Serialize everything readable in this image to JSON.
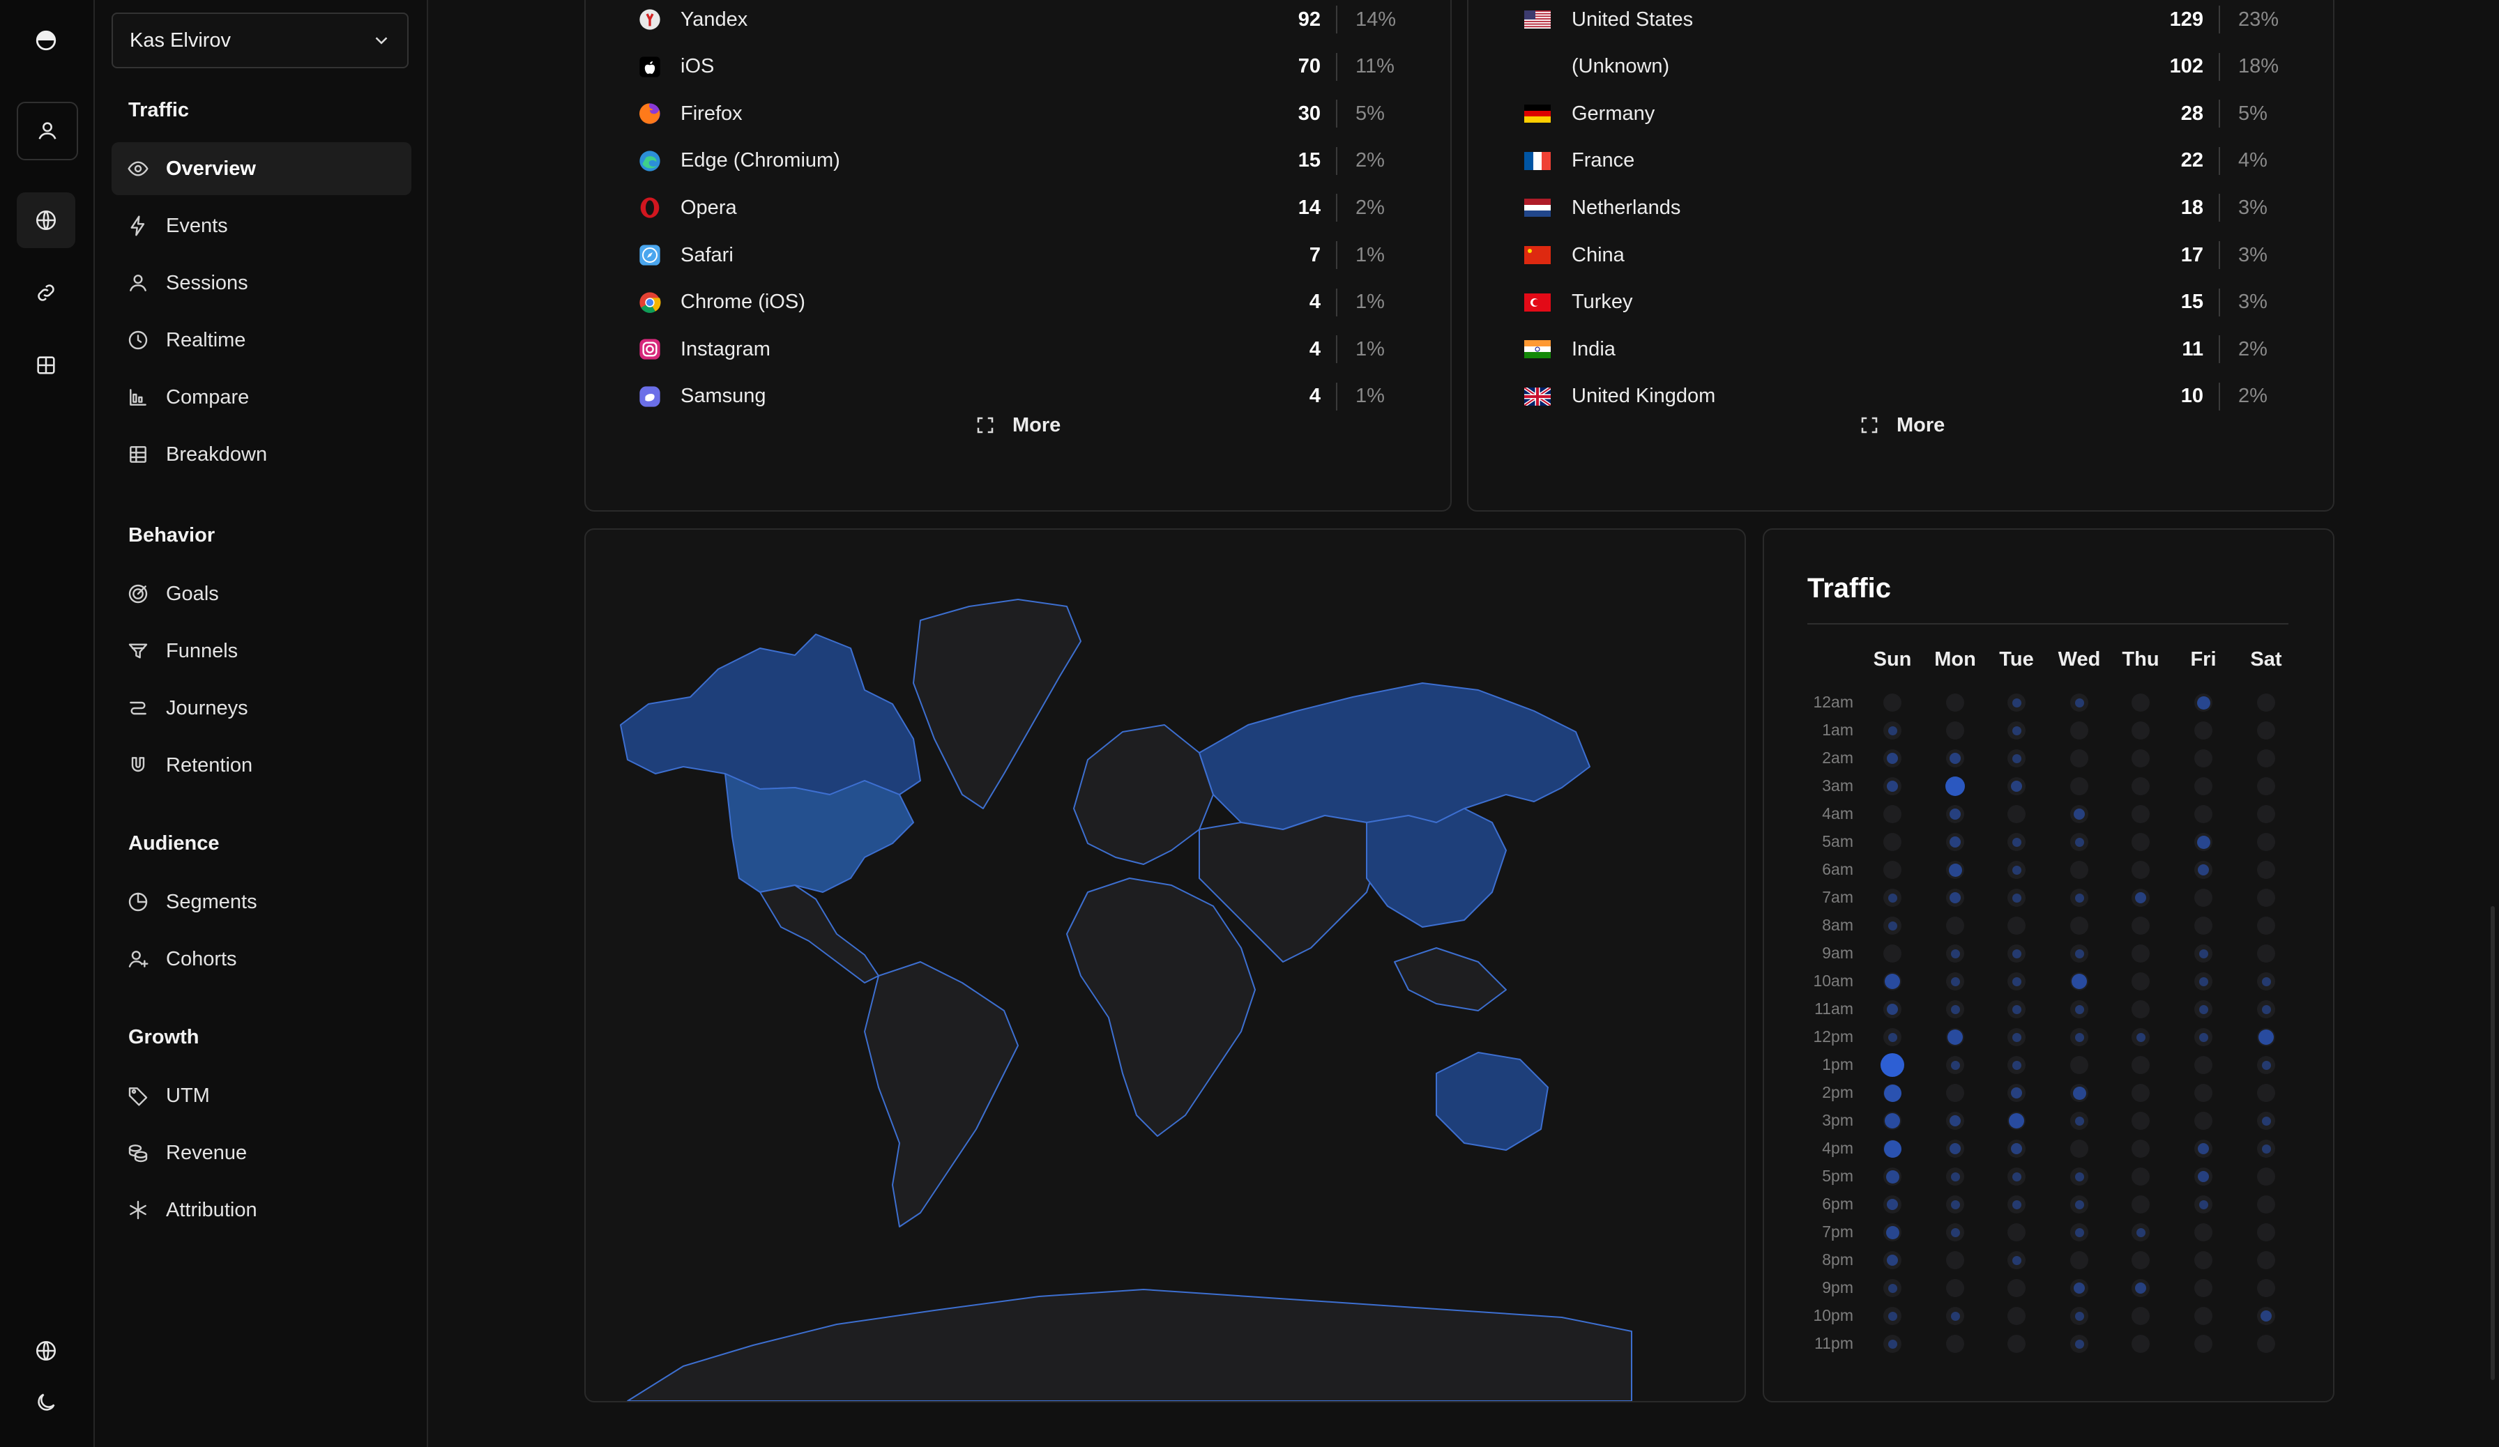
{
  "sidebar": {
    "team": "Kas Elvirov",
    "sections": [
      {
        "title": "Traffic",
        "items": [
          {
            "label": "Overview",
            "icon": "eye-icon",
            "active": true
          },
          {
            "label": "Events",
            "icon": "lightning-icon"
          },
          {
            "label": "Sessions",
            "icon": "user-icon"
          },
          {
            "label": "Realtime",
            "icon": "clock-icon"
          },
          {
            "label": "Compare",
            "icon": "compare-chart-icon"
          },
          {
            "label": "Breakdown",
            "icon": "table-icon"
          }
        ]
      },
      {
        "title": "Behavior",
        "items": [
          {
            "label": "Goals",
            "icon": "target-icon"
          },
          {
            "label": "Funnels",
            "icon": "funnel-icon"
          },
          {
            "label": "Journeys",
            "icon": "journey-icon"
          },
          {
            "label": "Retention",
            "icon": "magnet-icon"
          }
        ]
      },
      {
        "title": "Audience",
        "items": [
          {
            "label": "Segments",
            "icon": "pie-icon"
          },
          {
            "label": "Cohorts",
            "icon": "user-plus-icon"
          }
        ]
      },
      {
        "title": "Growth",
        "items": [
          {
            "label": "UTM",
            "icon": "tag-icon"
          },
          {
            "label": "Revenue",
            "icon": "coins-icon"
          },
          {
            "label": "Attribution",
            "icon": "asterisk-icon"
          }
        ]
      }
    ]
  },
  "browsers": {
    "rows": [
      {
        "label": "Yandex",
        "count": "92",
        "pct": "14%",
        "icon": "yandex-icon",
        "color": "#e8e8e8",
        "mark": "#d22222"
      },
      {
        "label": "iOS",
        "count": "70",
        "pct": "11%",
        "icon": "apple-icon",
        "color": "#ffffff",
        "mark": "#000000"
      },
      {
        "label": "Firefox",
        "count": "30",
        "pct": "5%",
        "icon": "firefox-icon",
        "color": "#ff7a1a",
        "mark": "#8a3ad6"
      },
      {
        "label": "Edge (Chromium)",
        "count": "15",
        "pct": "2%",
        "icon": "edge-icon",
        "color": "#2c8fd8",
        "mark": "#3ed08a"
      },
      {
        "label": "Opera",
        "count": "14",
        "pct": "2%",
        "icon": "opera-icon",
        "color": "#d1161f",
        "mark": "#131313"
      },
      {
        "label": "Safari",
        "count": "7",
        "pct": "1%",
        "icon": "safari-icon",
        "color": "#4aa6ee",
        "mark": "#ffffff"
      },
      {
        "label": "Chrome (iOS)",
        "count": "4",
        "pct": "1%",
        "icon": "chrome-icon",
        "color": "#e34133",
        "mark": "#4285f4"
      },
      {
        "label": "Instagram",
        "count": "4",
        "pct": "1%",
        "icon": "instagram-icon",
        "color": "#d6287a",
        "mark": "#ffffff"
      },
      {
        "label": "Samsung",
        "count": "4",
        "pct": "1%",
        "icon": "samsung-icon",
        "color": "#6b6fe8",
        "mark": "#ffffff"
      }
    ],
    "more_label": "More"
  },
  "countries": {
    "rows": [
      {
        "label": "United States",
        "count": "129",
        "pct": "23%",
        "flag": "us"
      },
      {
        "label": "(Unknown)",
        "count": "102",
        "pct": "18%",
        "flag": "none"
      },
      {
        "label": "Germany",
        "count": "28",
        "pct": "5%",
        "flag": "de"
      },
      {
        "label": "France",
        "count": "22",
        "pct": "4%",
        "flag": "fr"
      },
      {
        "label": "Netherlands",
        "count": "18",
        "pct": "3%",
        "flag": "nl"
      },
      {
        "label": "China",
        "count": "17",
        "pct": "3%",
        "flag": "cn"
      },
      {
        "label": "Turkey",
        "count": "15",
        "pct": "3%",
        "flag": "tr"
      },
      {
        "label": "India",
        "count": "11",
        "pct": "2%",
        "flag": "in"
      },
      {
        "label": "United Kingdom",
        "count": "10",
        "pct": "2%",
        "flag": "gb"
      }
    ],
    "more_label": "More"
  },
  "map": {
    "accent": "#1e3f7a",
    "accent_strong": "#24508f",
    "border_color": "#3d6fd0",
    "base_color": "#1e1e20"
  },
  "traffic": {
    "title": "Traffic",
    "days": [
      "Sun",
      "Mon",
      "Tue",
      "Wed",
      "Thu",
      "Fri",
      "Sat"
    ],
    "hours": [
      "12am",
      "1am",
      "2am",
      "3am",
      "4am",
      "5am",
      "6am",
      "7am",
      "8am",
      "9am",
      "10am",
      "11am",
      "12pm",
      "1pm",
      "2pm",
      "3pm",
      "4pm",
      "5pm",
      "6pm",
      "7pm",
      "8pm",
      "9pm",
      "10pm",
      "11pm"
    ],
    "levels": [
      [
        0,
        0,
        1,
        1,
        0,
        3,
        0
      ],
      [
        1,
        0,
        1,
        0,
        0,
        0,
        0
      ],
      [
        2,
        2,
        1,
        0,
        0,
        0,
        0
      ],
      [
        2,
        6,
        2,
        0,
        0,
        0,
        0
      ],
      [
        0,
        2,
        0,
        2,
        0,
        0,
        0
      ],
      [
        0,
        2,
        1,
        1,
        0,
        3,
        0
      ],
      [
        0,
        3,
        1,
        0,
        0,
        2,
        0
      ],
      [
        1,
        2,
        1,
        1,
        2,
        0,
        0
      ],
      [
        1,
        0,
        0,
        0,
        0,
        0,
        0
      ],
      [
        0,
        1,
        1,
        1,
        0,
        1,
        0
      ],
      [
        4,
        1,
        1,
        4,
        0,
        1,
        1
      ],
      [
        2,
        1,
        1,
        1,
        0,
        1,
        1
      ],
      [
        1,
        4,
        1,
        1,
        1,
        1,
        4
      ],
      [
        8,
        1,
        1,
        0,
        0,
        0,
        1
      ],
      [
        5,
        0,
        2,
        3,
        0,
        0,
        0
      ],
      [
        4,
        2,
        4,
        1,
        0,
        0,
        1
      ],
      [
        5,
        2,
        2,
        0,
        0,
        2,
        1
      ],
      [
        3,
        1,
        1,
        1,
        0,
        2,
        0
      ],
      [
        2,
        1,
        1,
        1,
        0,
        1,
        0
      ],
      [
        3,
        1,
        0,
        1,
        1,
        0,
        0
      ],
      [
        2,
        0,
        1,
        0,
        0,
        0,
        0
      ],
      [
        1,
        0,
        0,
        2,
        2,
        0,
        0
      ],
      [
        1,
        1,
        0,
        1,
        0,
        0,
        2
      ],
      [
        1,
        0,
        0,
        1,
        0,
        0,
        0
      ]
    ],
    "dot_color": "#2d5fd4"
  }
}
